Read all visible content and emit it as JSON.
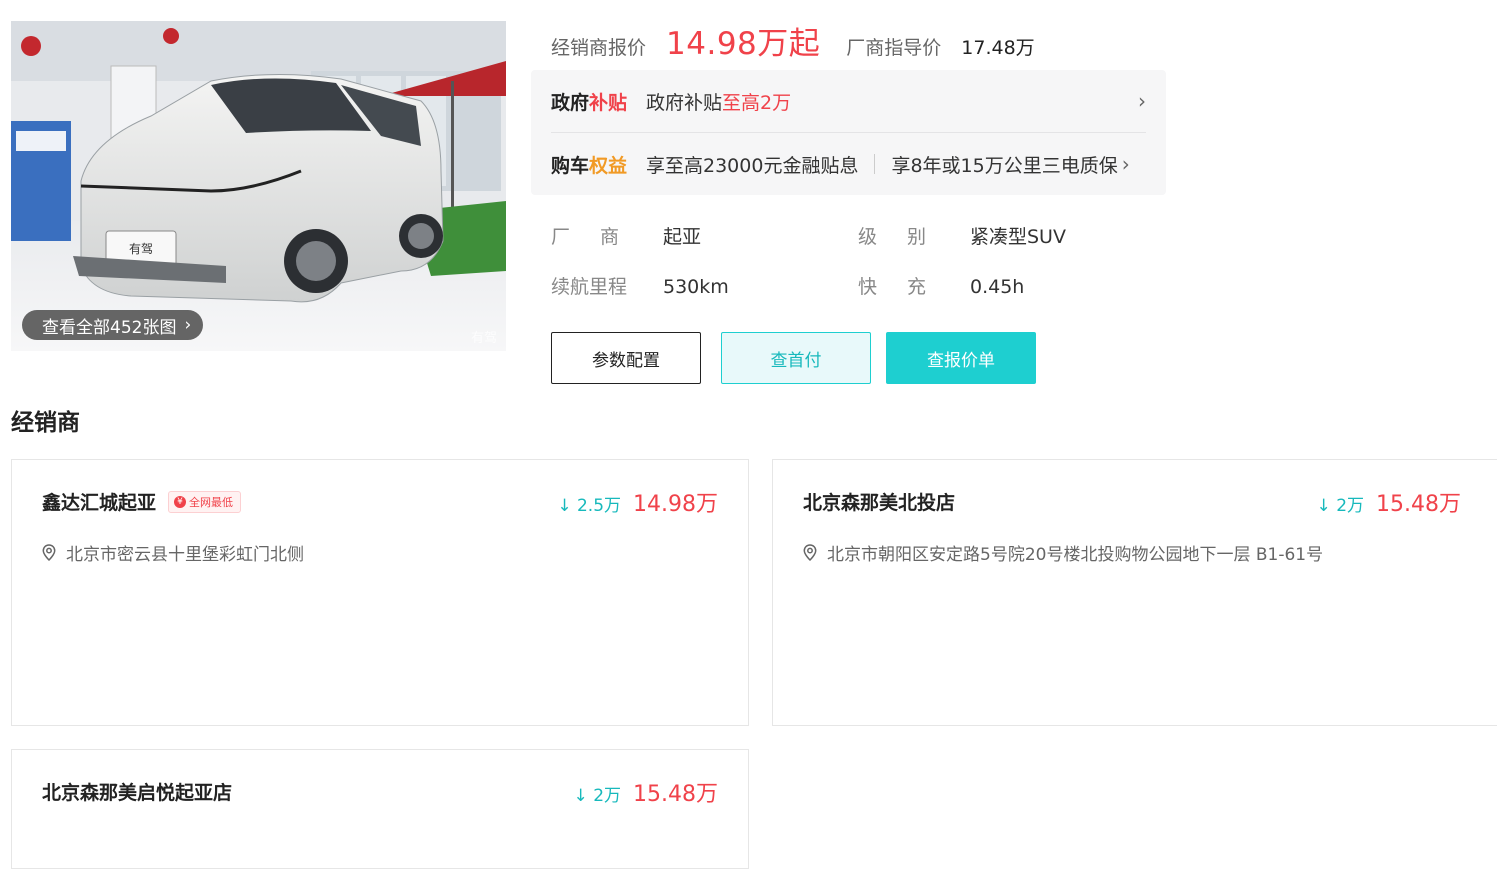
{
  "gallery": {
    "view_all_label": "查看全部452张图",
    "watermark": "有驾"
  },
  "pricing": {
    "dealer_label": "经销商报价",
    "dealer_price": "14.98万起",
    "msrp_label": "厂商指导价",
    "msrp": "17.48万"
  },
  "benefits": {
    "subsidy": {
      "title_a": "政府",
      "title_b": "补贴",
      "text_a": "政府补贴",
      "text_b": "至高2万"
    },
    "rights": {
      "title_a": "购车",
      "title_b": "权益",
      "text_1": "享至高23000元金融贴息",
      "text_2": "享8年或15万公里三电质保"
    }
  },
  "specs": {
    "maker_label": "厂商",
    "maker": "起亚",
    "class_label": "级别",
    "class": "紧凑型SUV",
    "range_label": "续航里程",
    "range": "530km",
    "charge_label": "快充",
    "charge": "0.45h"
  },
  "actions": {
    "config": "参数配置",
    "down_payment": "查首付",
    "quote": "查报价单"
  },
  "dealers_section": {
    "title": "经销商",
    "items": [
      {
        "name": "鑫达汇城起亚",
        "badge": "全网最低",
        "drop": "↓ 2.5万",
        "price": "14.98万",
        "address": "北京市密云县十里堡彩虹门北侧"
      },
      {
        "name": "北京森那美北投店",
        "drop": "↓ 2万",
        "price": "15.48万",
        "address": "北京市朝阳区安定路5号院20号楼北投购物公园地下一层 B1-61号"
      },
      {
        "name": "北京森那美启悦起亚店",
        "drop": "↓ 2万",
        "price": "15.48万"
      }
    ]
  },
  "colors": {
    "price_red": "#f0424a",
    "accent_teal": "#1ecfd0",
    "benefit_orange": "#f19a25"
  }
}
